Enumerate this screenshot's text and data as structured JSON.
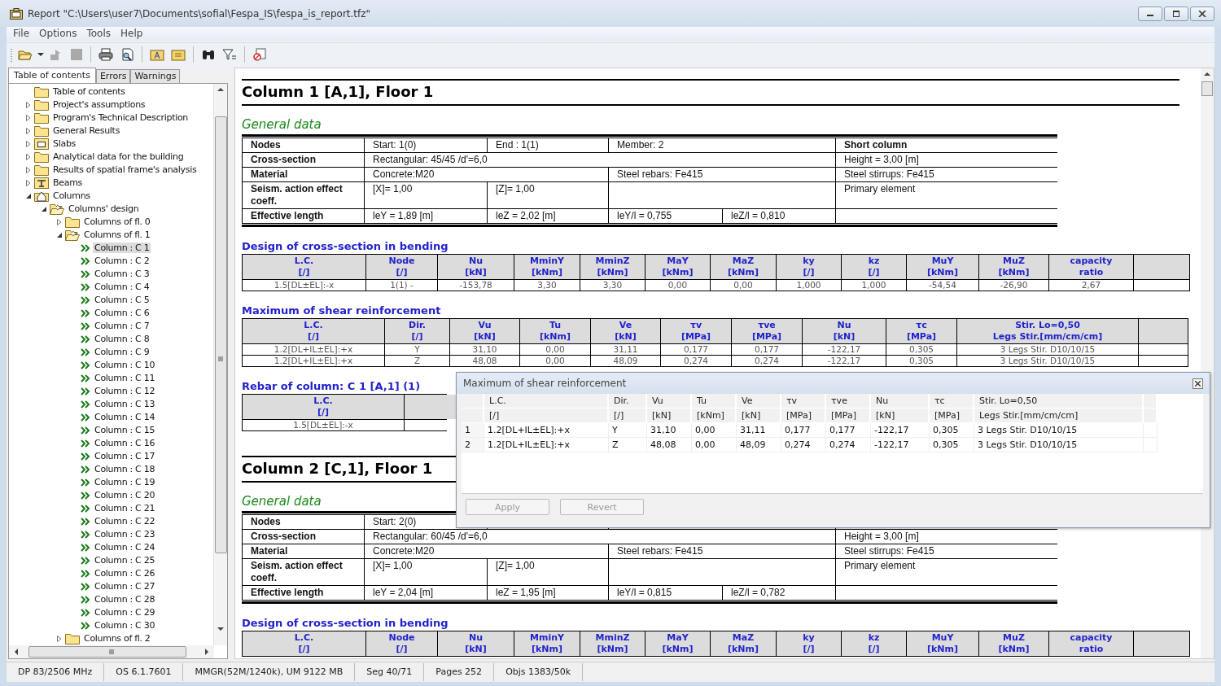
{
  "window": {
    "title": "Report \"C:\\Users\\user7\\Documents\\sofial\\Fespa_IS\\fespa_is_report.tfz\""
  },
  "menu": [
    "File",
    "Options",
    "Tools",
    "Help"
  ],
  "tabs": [
    {
      "label": "Table of contents",
      "selected": true
    },
    {
      "label": "Errors",
      "selected": false
    },
    {
      "label": "Warnings",
      "selected": false
    }
  ],
  "tree": {
    "items": [
      {
        "label": "Table of contents",
        "kind": "folder",
        "selected": false
      },
      {
        "label": "Project's assumptions",
        "kind": "folder",
        "expanded": false,
        "selected": false
      },
      {
        "label": "Program's Technical Description",
        "kind": "folder",
        "expanded": false,
        "selected": false
      },
      {
        "label": "General Results",
        "kind": "folder",
        "expanded": false,
        "selected": false
      },
      {
        "label": "Slabs",
        "kind": "slab",
        "expanded": false,
        "selected": false
      },
      {
        "label": "Analytical data for the building",
        "kind": "folder",
        "expanded": false,
        "selected": false
      },
      {
        "label": "Results of spatial frame's analysis",
        "kind": "folder",
        "expanded": false,
        "selected": false
      },
      {
        "label": "Beams",
        "kind": "beam",
        "expanded": false,
        "selected": false
      },
      {
        "label": "Columns",
        "kind": "column",
        "expanded": true,
        "selected": false,
        "children": [
          {
            "label": "Columns' design",
            "kind": "folder",
            "expanded": true,
            "selected": false,
            "children": [
              {
                "label": "Columns of fl. 0",
                "kind": "folder",
                "expanded": false,
                "selected": false
              },
              {
                "label": "Columns of fl. 1",
                "kind": "folder",
                "expanded": true,
                "selected": false,
                "children": [
                  {
                    "label": "Column : C 1",
                    "kind": "item",
                    "selected": true
                  },
                  {
                    "label": "Column : C 2",
                    "kind": "item",
                    "selected": false
                  },
                  {
                    "label": "Column : C 3",
                    "kind": "item",
                    "selected": false
                  },
                  {
                    "label": "Column : C 4",
                    "kind": "item",
                    "selected": false
                  },
                  {
                    "label": "Column : C 5",
                    "kind": "item",
                    "selected": false
                  },
                  {
                    "label": "Column : C 6",
                    "kind": "item",
                    "selected": false
                  },
                  {
                    "label": "Column : C 7",
                    "kind": "item",
                    "selected": false
                  },
                  {
                    "label": "Column : C 8",
                    "kind": "item",
                    "selected": false
                  },
                  {
                    "label": "Column : C 9",
                    "kind": "item",
                    "selected": false
                  },
                  {
                    "label": "Column : C 10",
                    "kind": "item",
                    "selected": false
                  },
                  {
                    "label": "Column : C 11",
                    "kind": "item",
                    "selected": false
                  },
                  {
                    "label": "Column : C 12",
                    "kind": "item",
                    "selected": false
                  },
                  {
                    "label": "Column : C 13",
                    "kind": "item",
                    "selected": false
                  },
                  {
                    "label": "Column : C 14",
                    "kind": "item",
                    "selected": false
                  },
                  {
                    "label": "Column : C 15",
                    "kind": "item",
                    "selected": false
                  },
                  {
                    "label": "Column : C 16",
                    "kind": "item",
                    "selected": false
                  },
                  {
                    "label": "Column : C 17",
                    "kind": "item",
                    "selected": false
                  },
                  {
                    "label": "Column : C 18",
                    "kind": "item",
                    "selected": false
                  },
                  {
                    "label": "Column : C 19",
                    "kind": "item",
                    "selected": false
                  },
                  {
                    "label": "Column : C 20",
                    "kind": "item",
                    "selected": false
                  },
                  {
                    "label": "Column : C 21",
                    "kind": "item",
                    "selected": false
                  },
                  {
                    "label": "Column : C 22",
                    "kind": "item",
                    "selected": false
                  },
                  {
                    "label": "Column : C 23",
                    "kind": "item",
                    "selected": false
                  },
                  {
                    "label": "Column : C 24",
                    "kind": "item",
                    "selected": false
                  },
                  {
                    "label": "Column : C 25",
                    "kind": "item",
                    "selected": false
                  },
                  {
                    "label": "Column : C 26",
                    "kind": "item",
                    "selected": false
                  },
                  {
                    "label": "Column : C 27",
                    "kind": "item",
                    "selected": false
                  },
                  {
                    "label": "Column : C 28",
                    "kind": "item",
                    "selected": false
                  },
                  {
                    "label": "Column : C 29",
                    "kind": "item",
                    "selected": false
                  },
                  {
                    "label": "Column : C 30",
                    "kind": "item",
                    "selected": false
                  }
                ]
              },
              {
                "label": "Columns of fl. 2",
                "kind": "folder",
                "expanded": false,
                "selected": false
              }
            ]
          }
        ]
      }
    ]
  },
  "report": {
    "sections": [
      {
        "title": "Column 1 [A,1], Floor 1",
        "general_data": {
          "heading": "General data",
          "rows": [
            {
              "label": "Nodes",
              "values": [
                "Start: 1(0)",
                "End : 1(1)",
                "Member: 2"
              ],
              "note": {
                "text": "Short column",
                "bold": true
              }
            },
            {
              "label": "Cross-section",
              "values": [
                "Rectangular: 45/45 /d'=6,0"
              ],
              "note": {
                "text": "Height = 3,00 [m]",
                "bold": false
              }
            },
            {
              "label": "Material",
              "values": [
                "Concrete:M20",
                "Steel rebars: Fe415"
              ],
              "note": {
                "text": "Steel stirrups: Fe415",
                "bold": false
              }
            },
            {
              "label": "Seism. action effect coeff.",
              "values": [
                "[X]= 1,00",
                "[Z]= 1,00"
              ],
              "note": {
                "text": "Primary element",
                "bold": false
              }
            },
            {
              "label": "Effective length",
              "values": [
                "leY = 1,89 [m]",
                "leZ = 2,02 [m]",
                "leY/l = 0,755",
                "leZ/l = 0,810"
              ]
            }
          ]
        },
        "tables": [
          {
            "kind": "bending",
            "heading": "Design of cross-section in bending",
            "columns": [
              {
                "name": "L.C.",
                "unit": "[/]"
              },
              {
                "name": "Node",
                "unit": "[/]"
              },
              {
                "name": "Nu",
                "unit": "[kN]"
              },
              {
                "name": "MminY",
                "unit": "[kNm]"
              },
              {
                "name": "MminZ",
                "unit": "[kNm]"
              },
              {
                "name": "MaY",
                "unit": "[kNm]"
              },
              {
                "name": "MaZ",
                "unit": "[kNm]"
              },
              {
                "name": "ky",
                "unit": "[/]"
              },
              {
                "name": "kz",
                "unit": "[/]"
              },
              {
                "name": "MuY",
                "unit": "[kNm]"
              },
              {
                "name": "MuZ",
                "unit": "[kNm]"
              },
              {
                "name": "capacity",
                "unit": "ratio"
              }
            ],
            "rows": [
              [
                "1.5[DL±EL]:-x",
                "1(1) -",
                "-153,78",
                "3,30",
                "3,30",
                "0,00",
                "0,00",
                "1,000",
                "1,000",
                "-54,54",
                "-26,90",
                "2,67"
              ]
            ]
          },
          {
            "kind": "shear",
            "heading": "Maximum of shear reinforcement",
            "columns": [
              {
                "name": "L.C.",
                "unit": "[/]"
              },
              {
                "name": "Dir.",
                "unit": "[/]"
              },
              {
                "name": "Vu",
                "unit": "[kN]"
              },
              {
                "name": "Tu",
                "unit": "[kNm]"
              },
              {
                "name": "Ve",
                "unit": "[kN]"
              },
              {
                "name": "τv",
                "unit": "[MPa]"
              },
              {
                "name": "τve",
                "unit": "[MPa]"
              },
              {
                "name": "Nu",
                "unit": "[kN]"
              },
              {
                "name": "τc",
                "unit": "[MPa]"
              },
              {
                "name": "Stir. Lo=0,50",
                "unit": "Legs Stir.[mm/cm/cm]"
              }
            ],
            "rows": [
              [
                "1.2[DL+IL±EL]:+x",
                "Y",
                "31,10",
                "0,00",
                "31,11",
                "0,177",
                "0,177",
                "-122,17",
                "0,305",
                "3 Legs Stir. D10/10/15"
              ],
              [
                "1.2[DL+IL±EL]:+x",
                "Z",
                "48,08",
                "0,00",
                "48,09",
                "0,274",
                "0,274",
                "-122,17",
                "0,305",
                "3 Legs Stir. D10/10/15"
              ]
            ]
          },
          {
            "kind": "rebar",
            "heading": "Rebar of column:  C 1 [A,1] (1)",
            "columns": [
              {
                "name": "L.C.",
                "unit": "[/]"
              }
            ],
            "rows": [
              [
                "1.5[DL±EL]:-x"
              ]
            ]
          }
        ]
      },
      {
        "title": "Column 2 [C,1], Floor 1",
        "general_data": {
          "heading": "General data",
          "rows": [
            {
              "label": "Nodes",
              "values": [
                "Start: 2(0)"
              ]
            },
            {
              "label": "Cross-section",
              "values": [
                "Rectangular: 60/45 /d'=6,0"
              ],
              "note": {
                "text": "Height = 3,00 [m]",
                "bold": false
              }
            },
            {
              "label": "Material",
              "values": [
                "Concrete:M20",
                "Steel rebars: Fe415"
              ],
              "note": {
                "text": "Steel stirrups: Fe415",
                "bold": false
              }
            },
            {
              "label": "Seism. action effect coeff.",
              "values": [
                "[X]= 1,00",
                "[Z]= 1,00"
              ],
              "note": {
                "text": "Primary element",
                "bold": false
              }
            },
            {
              "label": "Effective length",
              "values": [
                "leY = 2,04 [m]",
                "leZ = 1,95 [m]",
                "leY/l = 0,815",
                "leZ/l = 0,782"
              ]
            }
          ]
        },
        "tables": [
          {
            "kind": "bending",
            "heading": "Design of cross-section in bending",
            "columns": [
              {
                "name": "L.C.",
                "unit": "[/]"
              },
              {
                "name": "Node",
                "unit": "[/]"
              },
              {
                "name": "Nu",
                "unit": "[kN]"
              },
              {
                "name": "MminY",
                "unit": "[kNm]"
              },
              {
                "name": "MminZ",
                "unit": "[kNm]"
              },
              {
                "name": "MaY",
                "unit": "[kNm]"
              },
              {
                "name": "MaZ",
                "unit": "[kNm]"
              },
              {
                "name": "ky",
                "unit": "[/]"
              },
              {
                "name": "kz",
                "unit": "[/]"
              },
              {
                "name": "MuY",
                "unit": "[kNm]"
              },
              {
                "name": "MuZ",
                "unit": "[kNm]"
              },
              {
                "name": "capacity",
                "unit": "ratio"
              }
            ]
          }
        ]
      }
    ]
  },
  "popup": {
    "title": "Maximum of shear reinforcement",
    "columns": [
      {
        "name": "L.C.",
        "unit": "[/]"
      },
      {
        "name": "Dir.",
        "unit": "[/]"
      },
      {
        "name": "Vu",
        "unit": "[kN]"
      },
      {
        "name": "Tu",
        "unit": "[kNm]"
      },
      {
        "name": "Ve",
        "unit": "[kN]"
      },
      {
        "name": "τv",
        "unit": "[MPa]"
      },
      {
        "name": "τve",
        "unit": "[MPa]"
      },
      {
        "name": "Nu",
        "unit": "[kN]"
      },
      {
        "name": "τc",
        "unit": "[MPa]"
      },
      {
        "name": "Stir. Lo=0,50",
        "unit": "Legs Stir.[mm/cm/cm]"
      }
    ],
    "rows": [
      {
        "num": "1",
        "cells": [
          "1.2[DL+IL±EL]:+x",
          "Y",
          "31,10",
          "0,00",
          "31,11",
          "0,177",
          "0,177",
          "-122,17",
          "0,305",
          "3 Legs Stir. D10/10/15"
        ]
      },
      {
        "num": "2",
        "cells": [
          "1.2[DL+IL±EL]:+x",
          "Z",
          "48,08",
          "0,00",
          "48,09",
          "0,274",
          "0,274",
          "-122,17",
          "0,305",
          "3 Legs Stir. D10/10/15"
        ]
      }
    ],
    "buttons": [
      {
        "label": "Apply",
        "disabled": true
      },
      {
        "label": "Revert",
        "disabled": true
      }
    ]
  },
  "status_bar": [
    "DP 83/2506 MHz",
    "OS 6.1.7601",
    "MMGR(52M/1240k), UM 9122 MB",
    "Seg 40/71",
    "Pages 252",
    "Objs 1383/50k"
  ]
}
